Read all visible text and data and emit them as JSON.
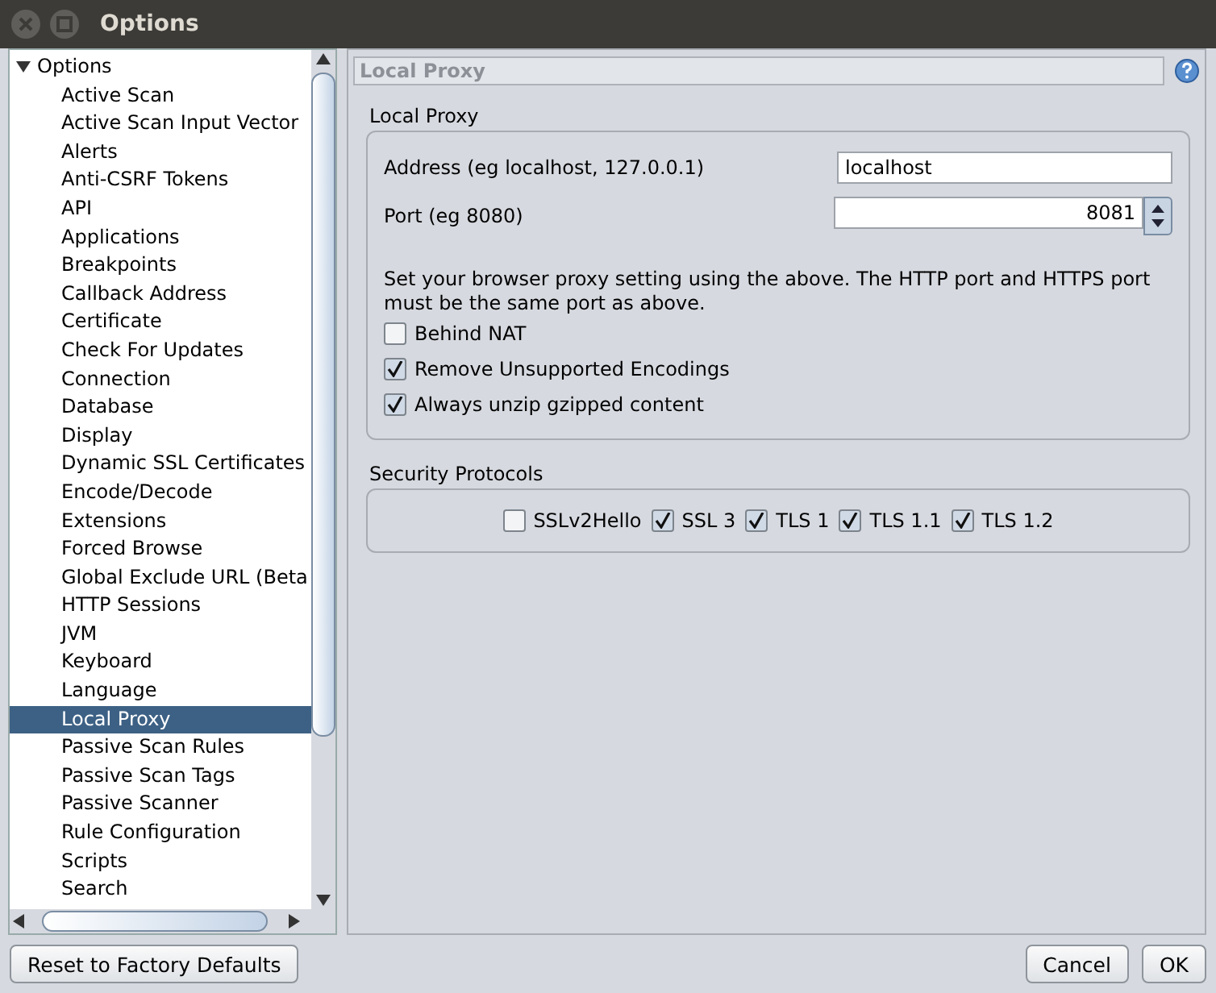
{
  "window": {
    "title": "Options"
  },
  "tree": {
    "root": {
      "label": "Options",
      "expanded": true
    },
    "children": [
      {
        "label": "Active Scan",
        "selected": false
      },
      {
        "label": "Active Scan Input Vector",
        "selected": false
      },
      {
        "label": "Alerts",
        "selected": false
      },
      {
        "label": "Anti-CSRF Tokens",
        "selected": false
      },
      {
        "label": "API",
        "selected": false
      },
      {
        "label": "Applications",
        "selected": false
      },
      {
        "label": "Breakpoints",
        "selected": false
      },
      {
        "label": "Callback Address",
        "selected": false
      },
      {
        "label": "Certificate",
        "selected": false
      },
      {
        "label": "Check For Updates",
        "selected": false
      },
      {
        "label": "Connection",
        "selected": false
      },
      {
        "label": "Database",
        "selected": false
      },
      {
        "label": "Display",
        "selected": false
      },
      {
        "label": "Dynamic SSL Certificates",
        "selected": false
      },
      {
        "label": "Encode/Decode",
        "selected": false
      },
      {
        "label": "Extensions",
        "selected": false
      },
      {
        "label": "Forced Browse",
        "selected": false
      },
      {
        "label": "Global Exclude URL (Beta",
        "selected": false
      },
      {
        "label": "HTTP Sessions",
        "selected": false
      },
      {
        "label": "JVM",
        "selected": false
      },
      {
        "label": "Keyboard",
        "selected": false
      },
      {
        "label": "Language",
        "selected": false
      },
      {
        "label": "Local Proxy",
        "selected": true
      },
      {
        "label": "Passive Scan Rules",
        "selected": false
      },
      {
        "label": "Passive Scan Tags",
        "selected": false
      },
      {
        "label": "Passive Scanner",
        "selected": false
      },
      {
        "label": "Rule Configuration",
        "selected": false
      },
      {
        "label": "Scripts",
        "selected": false
      },
      {
        "label": "Search",
        "selected": false
      }
    ]
  },
  "panel": {
    "title": "Local Proxy",
    "local_proxy": {
      "heading": "Local Proxy",
      "address": {
        "label": "Address (eg localhost, 127.0.0.1)",
        "value": "localhost"
      },
      "port": {
        "label": "Port (eg 8080)",
        "value": "8081"
      },
      "note": "Set your browser proxy setting using the above. The HTTP port and HTTPS port must be the same port as above.",
      "options": [
        {
          "label": "Behind NAT",
          "checked": false
        },
        {
          "label": "Remove Unsupported Encodings",
          "checked": true
        },
        {
          "label": "Always unzip gzipped content",
          "checked": true
        }
      ]
    },
    "security": {
      "heading": "Security Protocols",
      "protocols": [
        {
          "label": "SSLv2Hello",
          "checked": false
        },
        {
          "label": "SSL 3",
          "checked": true
        },
        {
          "label": "TLS 1",
          "checked": true
        },
        {
          "label": "TLS 1.1",
          "checked": true
        },
        {
          "label": "TLS 1.2",
          "checked": true
        }
      ]
    }
  },
  "buttons": {
    "reset": "Reset to Factory Defaults",
    "cancel": "Cancel",
    "ok": "OK"
  }
}
